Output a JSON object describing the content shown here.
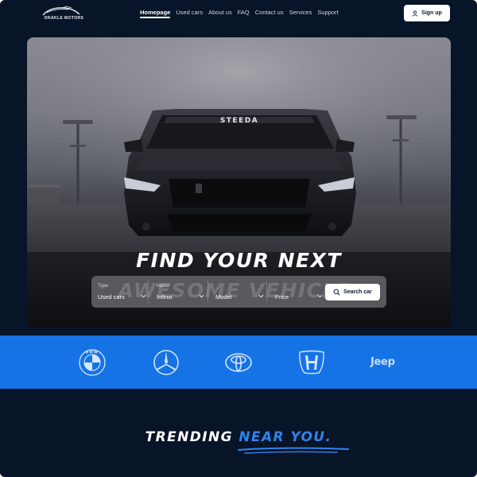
{
  "brand": {
    "name": "DRAKLE MOTORS"
  },
  "nav": {
    "items": [
      {
        "label": "Homepage",
        "active": true
      },
      {
        "label": "Used cars"
      },
      {
        "label": "About us"
      },
      {
        "label": "FAQ"
      },
      {
        "label": "Contact us"
      },
      {
        "label": "Services"
      },
      {
        "label": "Support"
      }
    ],
    "signup_label": "Sign up"
  },
  "hero": {
    "headline_line1": "FIND YOUR NEXT",
    "headline_line2": "AWESOME VEHICLE.",
    "windshield_text": "STEEDA"
  },
  "search": {
    "fields": [
      {
        "label": "Type",
        "value": "Used cars"
      },
      {
        "label": "Maker",
        "value": "Infiniti"
      },
      {
        "label": "",
        "value": "Model"
      },
      {
        "label": "",
        "value": "Price"
      }
    ],
    "button_label": "Search car"
  },
  "brands": {
    "items": [
      "bmw-logo",
      "mercedes-logo",
      "toyota-logo",
      "honda-logo",
      "jeep-logo"
    ],
    "bmw_text": "BMW",
    "jeep_text": "Jeep"
  },
  "trending": {
    "prefix": "TRENDING",
    "accent": "NEAR YOU."
  },
  "colors": {
    "background": "#081427",
    "accent": "#1673e6",
    "accent_text": "#2f84ee"
  }
}
